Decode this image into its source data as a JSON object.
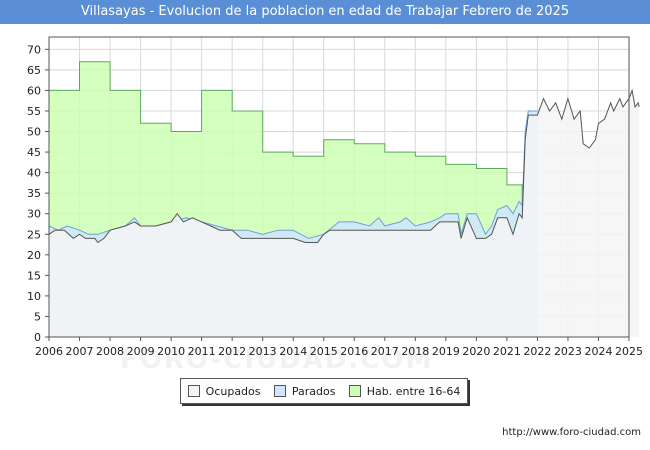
{
  "chart_data": {
    "type": "area",
    "title": "Villasayas - Evolucion de la poblacion en edad de Trabajar Febrero de 2025",
    "xlabel": "",
    "ylabel": "",
    "x_ticks": [
      "2006",
      "2007",
      "2008",
      "2009",
      "2010",
      "2011",
      "2012",
      "2013",
      "2014",
      "2015",
      "2016",
      "2017",
      "2018",
      "2019",
      "2020",
      "2021",
      "2022",
      "2023",
      "2024",
      "2025"
    ],
    "y_ticks": [
      0,
      5,
      10,
      15,
      20,
      25,
      30,
      35,
      40,
      45,
      50,
      55,
      60,
      65,
      70
    ],
    "xlim": [
      2006,
      2025
    ],
    "ylim": [
      0,
      73
    ],
    "grid": true,
    "legend_position": "bottom",
    "series": [
      {
        "name": "Hab. entre 16-64",
        "color": "#ccffb3",
        "stroke": "#5fa85f",
        "points": [
          [
            2006.0,
            60
          ],
          [
            2007.0,
            60
          ],
          [
            2007.0,
            67
          ],
          [
            2008.0,
            67
          ],
          [
            2008.0,
            60
          ],
          [
            2009.0,
            60
          ],
          [
            2009.0,
            52
          ],
          [
            2010.0,
            52
          ],
          [
            2010.0,
            50
          ],
          [
            2011.0,
            50
          ],
          [
            2011.0,
            60
          ],
          [
            2012.0,
            60
          ],
          [
            2012.0,
            55
          ],
          [
            2013.0,
            55
          ],
          [
            2013.0,
            45
          ],
          [
            2014.0,
            45
          ],
          [
            2014.0,
            44
          ],
          [
            2015.0,
            44
          ],
          [
            2015.0,
            48
          ],
          [
            2016.0,
            48
          ],
          [
            2016.0,
            47
          ],
          [
            2017.0,
            47
          ],
          [
            2017.0,
            45
          ],
          [
            2018.0,
            45
          ],
          [
            2018.0,
            44
          ],
          [
            2019.0,
            44
          ],
          [
            2019.0,
            42
          ],
          [
            2020.0,
            42
          ],
          [
            2020.0,
            41
          ],
          [
            2021.0,
            41
          ],
          [
            2021.0,
            37
          ],
          [
            2021.5,
            37
          ],
          [
            2021.5,
            27
          ]
        ]
      },
      {
        "name": "Parados",
        "color": "#cfe6ff",
        "stroke": "#6d9fd6",
        "points": [
          [
            2006.0,
            27
          ],
          [
            2006.3,
            26
          ],
          [
            2006.6,
            27
          ],
          [
            2007.0,
            26
          ],
          [
            2007.3,
            25
          ],
          [
            2007.6,
            25
          ],
          [
            2008.0,
            26
          ],
          [
            2008.5,
            27
          ],
          [
            2008.8,
            29
          ],
          [
            2009.0,
            27
          ],
          [
            2009.5,
            27
          ],
          [
            2010.0,
            28
          ],
          [
            2010.5,
            29
          ],
          [
            2011.0,
            28
          ],
          [
            2011.5,
            27
          ],
          [
            2012.0,
            26
          ],
          [
            2012.5,
            26
          ],
          [
            2013.0,
            25
          ],
          [
            2013.5,
            26
          ],
          [
            2014.0,
            26
          ],
          [
            2014.5,
            24
          ],
          [
            2015.0,
            25
          ],
          [
            2015.5,
            28
          ],
          [
            2016.0,
            28
          ],
          [
            2016.5,
            27
          ],
          [
            2016.8,
            29
          ],
          [
            2017.0,
            27
          ],
          [
            2017.5,
            28
          ],
          [
            2017.7,
            29
          ],
          [
            2018.0,
            27
          ],
          [
            2018.5,
            28
          ],
          [
            2018.8,
            29
          ],
          [
            2019.0,
            30
          ],
          [
            2019.4,
            30
          ],
          [
            2019.5,
            25
          ],
          [
            2019.7,
            30
          ],
          [
            2020.0,
            30
          ],
          [
            2020.3,
            25
          ],
          [
            2020.5,
            27
          ],
          [
            2020.7,
            31
          ],
          [
            2021.0,
            32
          ],
          [
            2021.2,
            30
          ],
          [
            2021.4,
            33
          ],
          [
            2021.5,
            32
          ],
          [
            2021.6,
            50
          ],
          [
            2021.7,
            55
          ],
          [
            2022.0,
            55
          ]
        ]
      },
      {
        "name": "Ocupados",
        "color": "#f4f4f4",
        "stroke": "#555555",
        "points": [
          [
            2006.0,
            25
          ],
          [
            2006.2,
            26
          ],
          [
            2006.5,
            26
          ],
          [
            2006.8,
            24
          ],
          [
            2007.0,
            25
          ],
          [
            2007.2,
            24
          ],
          [
            2007.5,
            24
          ],
          [
            2007.6,
            23
          ],
          [
            2007.8,
            24
          ],
          [
            2008.0,
            26
          ],
          [
            2008.5,
            27
          ],
          [
            2008.8,
            28
          ],
          [
            2009.0,
            27
          ],
          [
            2009.5,
            27
          ],
          [
            2010.0,
            28
          ],
          [
            2010.2,
            30
          ],
          [
            2010.4,
            28
          ],
          [
            2010.7,
            29
          ],
          [
            2011.0,
            28
          ],
          [
            2011.3,
            27
          ],
          [
            2011.6,
            26
          ],
          [
            2012.0,
            26
          ],
          [
            2012.3,
            24
          ],
          [
            2012.7,
            24
          ],
          [
            2013.0,
            24
          ],
          [
            2013.5,
            24
          ],
          [
            2014.0,
            24
          ],
          [
            2014.4,
            23
          ],
          [
            2014.8,
            23
          ],
          [
            2015.0,
            25
          ],
          [
            2015.2,
            26
          ],
          [
            2015.5,
            26
          ],
          [
            2016.0,
            26
          ],
          [
            2016.5,
            26
          ],
          [
            2017.0,
            26
          ],
          [
            2017.5,
            26
          ],
          [
            2018.0,
            26
          ],
          [
            2018.5,
            26
          ],
          [
            2018.8,
            28
          ],
          [
            2019.0,
            28
          ],
          [
            2019.4,
            28
          ],
          [
            2019.5,
            24
          ],
          [
            2019.7,
            29
          ],
          [
            2020.0,
            24
          ],
          [
            2020.3,
            24
          ],
          [
            2020.5,
            25
          ],
          [
            2020.7,
            29
          ],
          [
            2021.0,
            29
          ],
          [
            2021.2,
            25
          ],
          [
            2021.4,
            30
          ],
          [
            2021.5,
            29
          ],
          [
            2021.6,
            48
          ],
          [
            2021.7,
            54
          ],
          [
            2022.0,
            54
          ],
          [
            2022.2,
            58
          ],
          [
            2022.4,
            55
          ],
          [
            2022.6,
            57
          ],
          [
            2022.8,
            53
          ],
          [
            2023.0,
            58
          ],
          [
            2023.2,
            53
          ],
          [
            2023.4,
            55
          ],
          [
            2023.5,
            47
          ],
          [
            2023.7,
            46
          ],
          [
            2023.9,
            48
          ],
          [
            2024.0,
            52
          ],
          [
            2024.2,
            53
          ],
          [
            2024.4,
            57
          ],
          [
            2024.5,
            55
          ],
          [
            2024.7,
            58
          ],
          [
            2024.8,
            56
          ],
          [
            2025.0,
            58
          ],
          [
            2025.1,
            60
          ],
          [
            2025.2,
            56
          ],
          [
            2025.3,
            57
          ],
          [
            2025.33,
            56
          ]
        ]
      }
    ]
  },
  "legend": {
    "items": [
      {
        "label": "Ocupados",
        "color": "#f4f4f4"
      },
      {
        "label": "Parados",
        "color": "#cfe6ff"
      },
      {
        "label": "Hab. entre 16-64",
        "color": "#ccffb3"
      }
    ]
  },
  "source": "http://www.foro-ciudad.com",
  "watermark": "FORO-CIUDAD.COM"
}
